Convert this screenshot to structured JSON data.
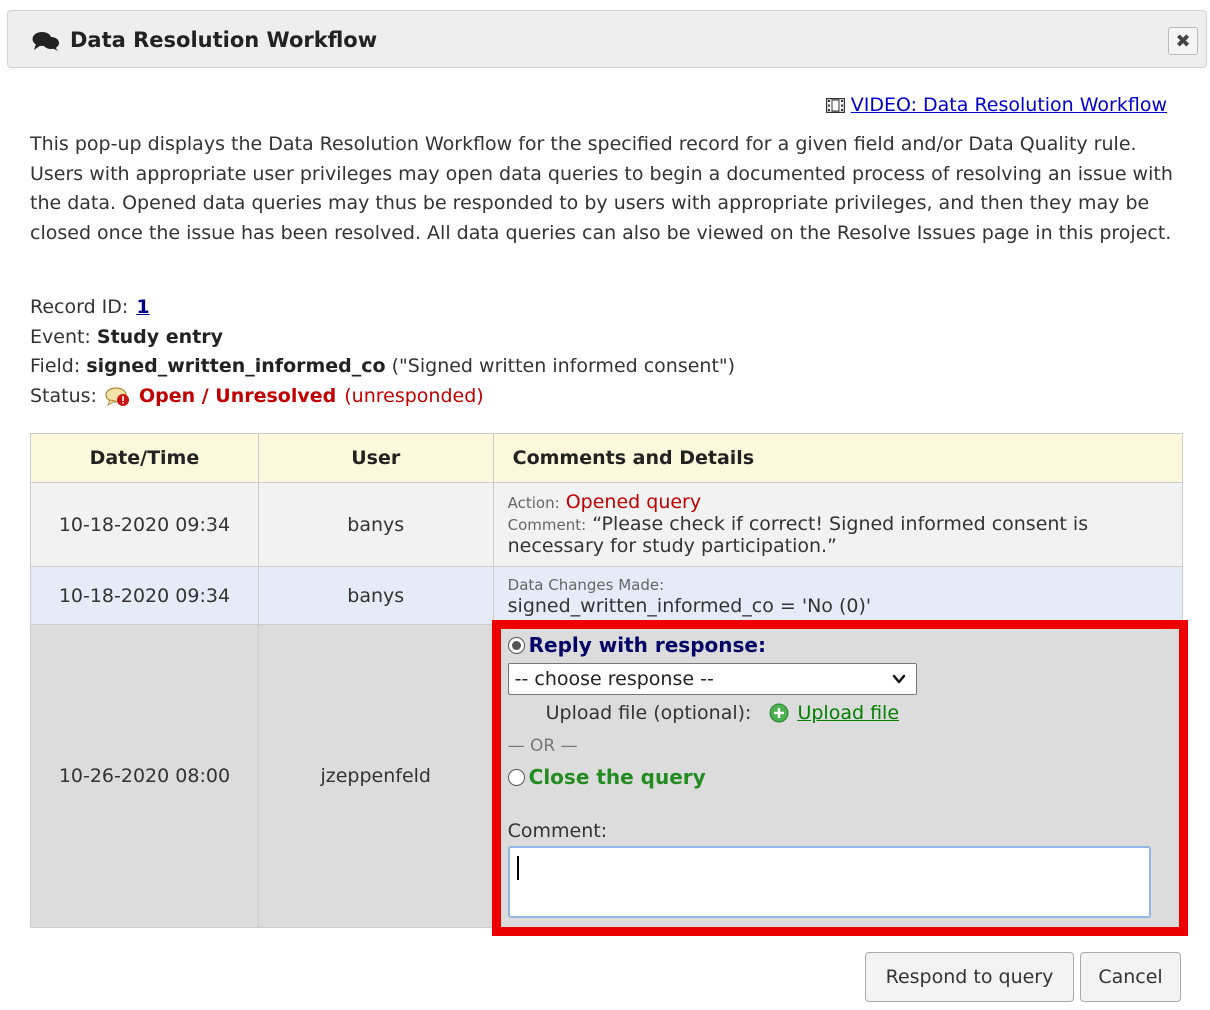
{
  "dialog": {
    "title": "Data Resolution Workflow",
    "close_symbol": "✖",
    "icons": {
      "title": "comments-icon",
      "close": "close-icon",
      "video": "film-icon",
      "status": "query-bubble-icon",
      "upload": "plus-circle-icon",
      "select": "chevron-down-icon"
    }
  },
  "video_link": "VIDEO: Data Resolution Workflow",
  "intro": "This pop-up displays the Data Resolution Workflow for the specified record for a given field and/or Data Quality rule. Users with appropriate user privileges may open data queries to begin a documented process of resolving an issue with the data. Opened data queries may thus be responded to by users with appropriate privileges, and then they may be closed once the issue has been resolved. All data queries can also be viewed on the Resolve Issues page in this project.",
  "record": {
    "id_label": "Record ID:",
    "id_value": "1",
    "event_label": "Event:",
    "event_value": "Study entry",
    "field_label": "Field:",
    "field_value": "signed_written_informed_co",
    "field_desc": "(\"Signed written informed consent\")",
    "status_label": "Status:",
    "status_value": "Open / Unresolved",
    "status_note": "(unresponded)"
  },
  "table": {
    "headers": [
      "Date/Time",
      "User",
      "Comments and Details"
    ],
    "rows": [
      {
        "datetime": "10-18-2020 09:34",
        "user": "banys",
        "action_label": "Action:",
        "action_value": "Opened query",
        "comment_label": "Comment:",
        "comment_value": "“Please check if correct! Signed informed consent is necessary for study participation.”"
      },
      {
        "datetime": "10-18-2020 09:34",
        "user": "banys",
        "changes_label": "Data Changes Made:",
        "changes_value": "signed_written_informed_co = 'No (0)'"
      },
      {
        "datetime": "10-26-2020 08:00",
        "user": "jzeppenfeld"
      }
    ]
  },
  "response_form": {
    "reply_label": "Reply with response:",
    "reply_selected": true,
    "select_value": "-- choose response --",
    "upload_label": "Upload file (optional):",
    "upload_link": "Upload file",
    "or_text": "— OR —",
    "close_label": "Close the query",
    "close_selected": false,
    "comment_label": "Comment:",
    "comment_value": "",
    "highlight_color": "#ee0000"
  },
  "buttons": {
    "respond": "Respond to query",
    "cancel": "Cancel"
  }
}
